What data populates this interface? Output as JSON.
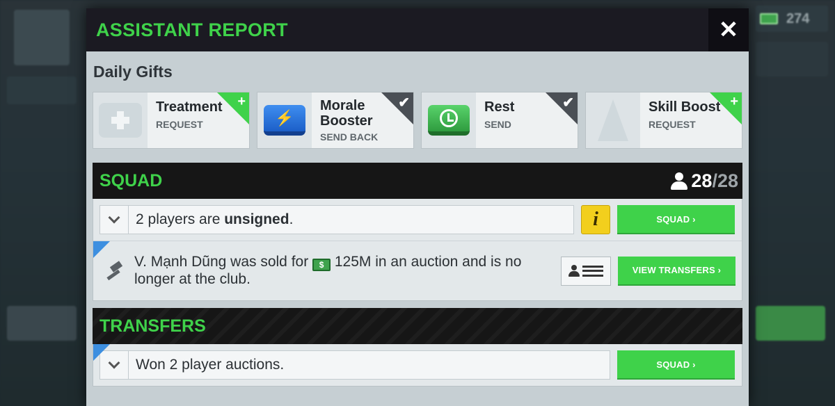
{
  "background": {
    "currency_value": "274"
  },
  "modal": {
    "title": "ASSISTANT REPORT",
    "close_label": "✕"
  },
  "daily_gifts": {
    "heading": "Daily Gifts",
    "items": [
      {
        "name": "Treatment",
        "action": "REQUEST",
        "icon": "medkit-icon",
        "status": "add"
      },
      {
        "name": "Morale Booster",
        "action": "SEND BACK",
        "icon": "lightning-icon",
        "status": "done"
      },
      {
        "name": "Rest",
        "action": "SEND",
        "icon": "clock-icon",
        "status": "done"
      },
      {
        "name": "Skill Boost",
        "action": "REQUEST",
        "icon": "cone-icon",
        "status": "add"
      }
    ],
    "add_mark": "+",
    "done_mark": "✔"
  },
  "squad": {
    "title": "SQUAD",
    "count_now": "28",
    "count_max": "/28",
    "rows": [
      {
        "text_pre": "2 players are ",
        "text_bold": "unsigned",
        "text_post": ".",
        "info": "i",
        "button": "SQUAD ›"
      },
      {
        "text_pre": "V. Mạnh Dũng was sold for ",
        "amount": "125M",
        "text_post": " in an auction and is no longer at the club.",
        "cash_symbol": "$",
        "button": "VIEW TRANSFERS ›"
      }
    ]
  },
  "transfers": {
    "title": "TRANSFERS",
    "rows": [
      {
        "text": "Won 2 player auctions.",
        "button": "SQUAD ›"
      }
    ]
  },
  "colors": {
    "accent_green": "#3fd24a",
    "header_dark": "#1b1a22",
    "info_yellow": "#f2cf1d"
  }
}
